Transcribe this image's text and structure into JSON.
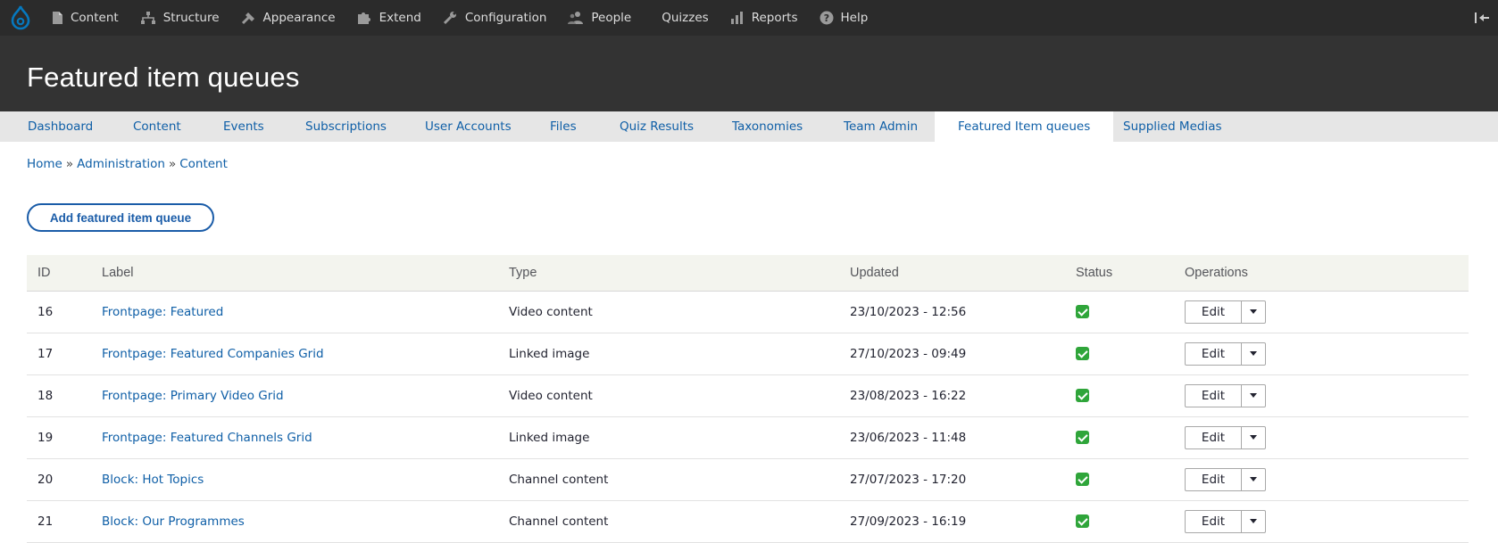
{
  "toolbar": {
    "items": [
      {
        "label": "Content",
        "icon": "file-icon"
      },
      {
        "label": "Structure",
        "icon": "structure-icon"
      },
      {
        "label": "Appearance",
        "icon": "paint-icon"
      },
      {
        "label": "Extend",
        "icon": "puzzle-icon"
      },
      {
        "label": "Configuration",
        "icon": "wrench-icon"
      },
      {
        "label": "People",
        "icon": "people-icon"
      },
      {
        "label": "Quizzes",
        "icon": ""
      },
      {
        "label": "Reports",
        "icon": "bar-chart-icon"
      },
      {
        "label": "Help",
        "icon": "help-icon"
      }
    ],
    "accent": "#0678be"
  },
  "header": {
    "title": "Featured item queues"
  },
  "tabs": [
    {
      "label": "Dashboard"
    },
    {
      "label": "Content"
    },
    {
      "label": "Events"
    },
    {
      "label": "Subscriptions"
    },
    {
      "label": "User Accounts"
    },
    {
      "label": "Files"
    },
    {
      "label": "Quiz Results"
    },
    {
      "label": "Taxonomies"
    },
    {
      "label": "Team Admin"
    },
    {
      "label": "Featured Item queues",
      "active": true
    },
    {
      "label": "Supplied Medias"
    }
  ],
  "breadcrumb": [
    {
      "label": "Home"
    },
    {
      "label": "Administration"
    },
    {
      "label": "Content"
    }
  ],
  "breadcrumb_separator": "»",
  "action": {
    "label": "Add featured item queue"
  },
  "table": {
    "headers": {
      "id": "ID",
      "label": "Label",
      "type": "Type",
      "updated": "Updated",
      "status": "Status",
      "operations": "Operations"
    },
    "rows": [
      {
        "id": "16",
        "label": "Frontpage: Featured",
        "type": "Video content",
        "updated": "23/10/2023 - 12:56",
        "status": "published",
        "op": "Edit"
      },
      {
        "id": "17",
        "label": "Frontpage: Featured Companies Grid",
        "type": "Linked image",
        "updated": "27/10/2023 - 09:49",
        "status": "published",
        "op": "Edit"
      },
      {
        "id": "18",
        "label": "Frontpage: Primary Video Grid",
        "type": "Video content",
        "updated": "23/08/2023 - 16:22",
        "status": "published",
        "op": "Edit"
      },
      {
        "id": "19",
        "label": "Frontpage: Featured Channels Grid",
        "type": "Linked image",
        "updated": "23/06/2023 - 11:48",
        "status": "published",
        "op": "Edit"
      },
      {
        "id": "20",
        "label": "Block: Hot Topics",
        "type": "Channel content",
        "updated": "27/07/2023 - 17:20",
        "status": "published",
        "op": "Edit"
      },
      {
        "id": "21",
        "label": "Block: Our Programmes",
        "type": "Channel content",
        "updated": "27/09/2023 - 16:19",
        "status": "published",
        "op": "Edit"
      }
    ]
  }
}
